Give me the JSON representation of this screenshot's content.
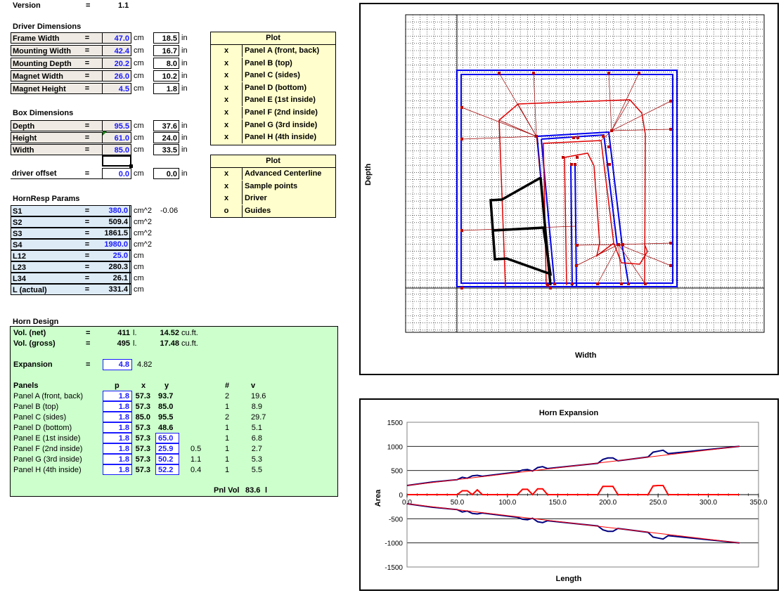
{
  "version": {
    "label": "Version",
    "eq": "=",
    "value": "1.1"
  },
  "driver": {
    "title": "Driver Dimensions",
    "rows": [
      {
        "label": "Frame Width",
        "eq": "=",
        "cm": "47.0",
        "cm_unit": "cm",
        "inch": "18.5",
        "in_unit": "in"
      },
      {
        "label": "Mounting Width",
        "eq": "=",
        "cm": "42.4",
        "cm_unit": "cm",
        "inch": "16.7",
        "in_unit": "in"
      },
      {
        "label": "Mounting Depth",
        "eq": "=",
        "cm": "20.2",
        "cm_unit": "cm",
        "inch": "8.0",
        "in_unit": "in"
      },
      {
        "label": "Magnet Width",
        "eq": "=",
        "cm": "26.0",
        "cm_unit": "cm",
        "inch": "10.2",
        "in_unit": "in"
      },
      {
        "label": "Magnet Height",
        "eq": "=",
        "cm": "4.5",
        "cm_unit": "cm",
        "inch": "1.8",
        "in_unit": "in"
      }
    ]
  },
  "box": {
    "title": "Box Dimensions",
    "rows": [
      {
        "label": "Depth",
        "eq": "=",
        "cm": "95.5",
        "cm_unit": "cm",
        "inch": "37.6",
        "in_unit": "in"
      },
      {
        "label": "Height",
        "eq": "=",
        "cm": "61.0",
        "cm_unit": "cm",
        "inch": "24.0",
        "in_unit": "in"
      },
      {
        "label": "Width",
        "eq": "=",
        "cm": "85.0",
        "cm_unit": "cm",
        "inch": "33.5",
        "in_unit": "in"
      }
    ],
    "offset": {
      "label": "driver offset",
      "eq": "=",
      "cm": "0.0",
      "cm_unit": "cm",
      "inch": "0.0",
      "in_unit": "in"
    }
  },
  "hornresp": {
    "title": "HornResp Params",
    "rows": [
      {
        "label": "S1",
        "eq": "=",
        "value": "380.0",
        "unit": "cm^2",
        "extra": "-0.06",
        "blue": true
      },
      {
        "label": "S2",
        "eq": "=",
        "value": "509.4",
        "unit": "cm^2",
        "extra": "",
        "blue": false
      },
      {
        "label": "S3",
        "eq": "=",
        "value": "1861.5",
        "unit": "cm^2",
        "extra": "",
        "blue": false
      },
      {
        "label": "S4",
        "eq": "=",
        "value": "1980.0",
        "unit": "cm^2",
        "extra": "",
        "blue": true
      },
      {
        "label": "L12",
        "eq": "=",
        "value": "25.0",
        "unit": "cm",
        "extra": "",
        "blue": true
      },
      {
        "label": "L23",
        "eq": "=",
        "value": "280.3",
        "unit": "cm",
        "extra": "",
        "blue": false
      },
      {
        "label": "L34",
        "eq": "=",
        "value": "26.1",
        "unit": "cm",
        "extra": "",
        "blue": false
      },
      {
        "label": "L (actual)",
        "eq": "=",
        "value": "331.4",
        "unit": "cm",
        "extra": "",
        "blue": false
      }
    ]
  },
  "plot1": {
    "header": "Plot",
    "rows": [
      {
        "mark": "x",
        "name": "Panel A (front, back)"
      },
      {
        "mark": "x",
        "name": "Panel B (top)"
      },
      {
        "mark": "x",
        "name": "Panel C (sides)"
      },
      {
        "mark": "x",
        "name": "Panel D (bottom)"
      },
      {
        "mark": "x",
        "name": "Panel E (1st inside)"
      },
      {
        "mark": "x",
        "name": "Panel F (2nd inside)"
      },
      {
        "mark": "x",
        "name": "Panel G (3rd inside)"
      },
      {
        "mark": "x",
        "name": "Panel H (4th inside)"
      }
    ]
  },
  "plot2": {
    "header": "Plot",
    "rows": [
      {
        "mark": "x",
        "name": "Advanced Centerline"
      },
      {
        "mark": "x",
        "name": "Sample points"
      },
      {
        "mark": "x",
        "name": "Driver"
      },
      {
        "mark": "o",
        "name": "Guides"
      }
    ]
  },
  "horn": {
    "title": "Horn Design",
    "vol_net": {
      "label": "Vol. (net)",
      "eq": "=",
      "l": "411",
      "l_unit": "l.",
      "cuft": "14.52",
      "cuft_unit": "cu.ft."
    },
    "vol_gross": {
      "label": "Vol. (gross)",
      "eq": "=",
      "l": "495",
      "l_unit": "l.",
      "cuft": "17.48",
      "cuft_unit": "cu.ft."
    },
    "expansion": {
      "label": "Expansion",
      "eq": "=",
      "value": "4.8",
      "extra": "4.82"
    },
    "panels_header": {
      "label": "Panels",
      "p": "p",
      "x": "x",
      "y": "y",
      "n": "#",
      "v": "v"
    },
    "panels": [
      {
        "name": "Panel A (front, back)",
        "p": "1.8",
        "x": "57.3",
        "y": "93.7",
        "y_box": false,
        "extra": "",
        "n": "2",
        "v": "19.6"
      },
      {
        "name": "Panel B (top)",
        "p": "1.8",
        "x": "57.3",
        "y": "85.0",
        "y_box": false,
        "extra": "",
        "n": "1",
        "v": "8.9"
      },
      {
        "name": "Panel C (sides)",
        "p": "1.8",
        "x": "85.0",
        "y": "95.5",
        "y_box": false,
        "extra": "",
        "n": "2",
        "v": "29.7"
      },
      {
        "name": "Panel D (bottom)",
        "p": "1.8",
        "x": "57.3",
        "y": "48.6",
        "y_box": false,
        "extra": "",
        "n": "1",
        "v": "5.1"
      },
      {
        "name": "Panel E (1st inside)",
        "p": "1.8",
        "x": "57.3",
        "y": "65.0",
        "y_box": true,
        "extra": "",
        "n": "1",
        "v": "6.8"
      },
      {
        "name": "Panel F (2nd inside)",
        "p": "1.8",
        "x": "57.3",
        "y": "25.9",
        "y_box": true,
        "extra": "0.5",
        "n": "1",
        "v": "2.7"
      },
      {
        "name": "Panel G (3rd inside)",
        "p": "1.8",
        "x": "57.3",
        "y": "50.2",
        "y_box": true,
        "extra": "1.1",
        "n": "1",
        "v": "5.3"
      },
      {
        "name": "Panel H (4th inside)",
        "p": "1.8",
        "x": "57.3",
        "y": "52.2",
        "y_box": true,
        "extra": "0.4",
        "n": "1",
        "v": "5.5"
      }
    ],
    "pnl_vol": {
      "label": "Pnl Vol",
      "value": "83.6",
      "unit": "l"
    }
  },
  "layout_chart": {
    "xlabel": "Width",
    "ylabel": "Depth"
  },
  "chart_data": {
    "type": "line",
    "title": "Horn Expansion",
    "xlabel": "Length",
    "ylabel": "Area",
    "xlim": [
      0,
      350
    ],
    "ylim": [
      -1500,
      1500
    ],
    "xticks": [
      "0.0",
      "50.0",
      "100.0",
      "150.0",
      "200.0",
      "250.0",
      "300.0",
      "350.0"
    ],
    "yticks": [
      "1500",
      "1000",
      "500",
      "0",
      "-500",
      "-1000",
      "-1500"
    ],
    "grid": true,
    "series": [
      {
        "color": "#000080",
        "x": [
          0,
          25,
          50,
          55,
          60,
          65,
          70,
          75,
          110,
          115,
          120,
          125,
          130,
          135,
          140,
          190,
          195,
          200,
          205,
          210,
          240,
          245,
          250,
          255,
          260,
          331
        ],
        "y": [
          190,
          260,
          310,
          360,
          340,
          390,
          400,
          380,
          470,
          510,
          520,
          490,
          560,
          580,
          540,
          650,
          730,
          760,
          760,
          700,
          780,
          880,
          900,
          920,
          850,
          1000
        ]
      },
      {
        "color": "#ff0000",
        "x": [
          0,
          331
        ],
        "y": [
          190,
          1000
        ]
      },
      {
        "color": "#ff0000",
        "x": [
          0,
          50,
          55,
          60,
          65,
          70,
          75,
          110,
          115,
          120,
          125,
          130,
          135,
          140,
          190,
          195,
          200,
          205,
          210,
          240,
          245,
          250,
          255,
          260,
          331
        ],
        "y": [
          0,
          0,
          80,
          80,
          0,
          100,
          0,
          0,
          110,
          110,
          0,
          120,
          120,
          0,
          0,
          170,
          170,
          170,
          0,
          0,
          180,
          190,
          190,
          0,
          0
        ]
      },
      {
        "color": "#000080",
        "x": [
          0,
          25,
          50,
          55,
          60,
          65,
          70,
          75,
          110,
          115,
          120,
          125,
          130,
          135,
          140,
          190,
          195,
          200,
          205,
          210,
          240,
          245,
          250,
          255,
          260,
          331
        ],
        "y": [
          -190,
          -260,
          -310,
          -360,
          -340,
          -390,
          -400,
          -380,
          -470,
          -510,
          -520,
          -490,
          -560,
          -580,
          -540,
          -650,
          -730,
          -760,
          -760,
          -700,
          -780,
          -880,
          -900,
          -920,
          -850,
          -1000
        ]
      },
      {
        "color": "#ff0000",
        "x": [
          0,
          331
        ],
        "y": [
          -190,
          -1000
        ]
      }
    ]
  }
}
